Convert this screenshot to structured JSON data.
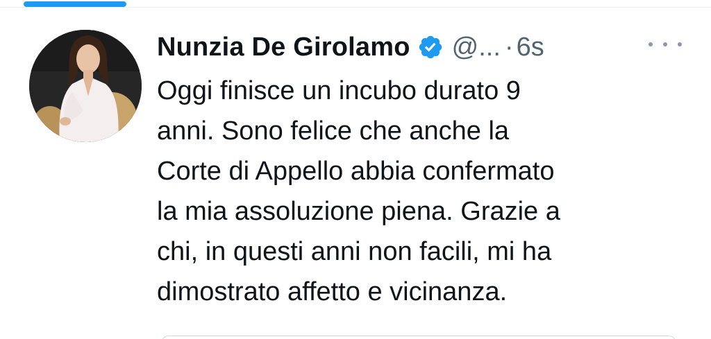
{
  "tweet": {
    "author_name": "Nunzia De Girolamo",
    "handle": "@...",
    "separator": "·",
    "timestamp": "6s",
    "verified": true,
    "text_lines": [
      "Oggi finisce un incubo durato 9",
      "anni. Sono felice che anche la",
      "Corte di Appello abbia confermato",
      "la mia assoluzione piena. Grazie a",
      "chi, in questi anni non facili, mi ha",
      "dimostrato affetto e vicinanza."
    ]
  },
  "icons": {
    "verified": "verified-badge-icon",
    "more": "more-options-icon"
  },
  "colors": {
    "accent": "#1d9bf0",
    "text_primary": "#0f1419",
    "text_secondary": "#536471"
  }
}
